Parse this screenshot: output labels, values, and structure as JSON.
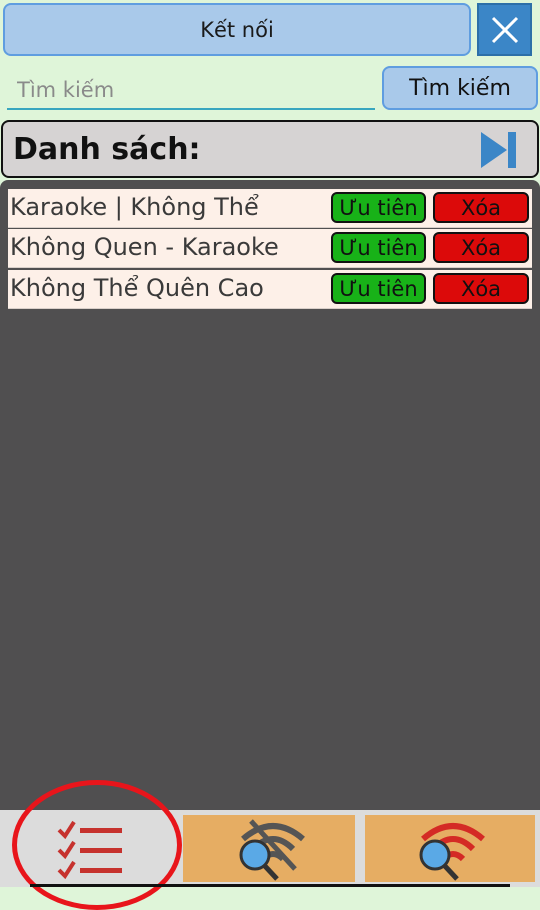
{
  "header": {
    "connect_label": "Kết nối",
    "close_icon": "close-icon"
  },
  "search": {
    "placeholder": "Tìm kiếm",
    "value": "",
    "button_label": "Tìm kiếm"
  },
  "list": {
    "title": "Danh sách:",
    "next_icon": "skip-next-icon",
    "songs": [
      {
        "title": "Karaoke | Không Thể",
        "priority_label": "Ưu tiên",
        "delete_label": "Xóa"
      },
      {
        "title": "Không Quen -  Karaoke",
        "priority_label": "Ưu tiên",
        "delete_label": "Xóa"
      },
      {
        "title": "Không Thể Quên Cao",
        "priority_label": "Ưu tiên",
        "delete_label": "Xóa"
      }
    ]
  },
  "bottom_nav": {
    "tabs": [
      {
        "name": "queue",
        "icon": "checklist-icon",
        "active": true
      },
      {
        "name": "search-offline",
        "icon": "wifi-off-search-icon"
      },
      {
        "name": "search-online",
        "icon": "wifi-search-icon"
      }
    ]
  },
  "colors": {
    "accent_blue": "#3b86c7",
    "priority_green": "#18b218",
    "delete_red": "#dc0a0a",
    "tab_orange": "#e6ad63",
    "highlight_red": "#e8151b"
  }
}
